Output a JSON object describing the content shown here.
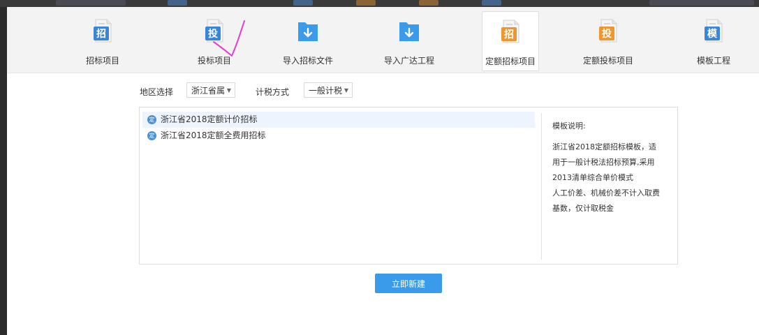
{
  "toolbar": {
    "items": [
      {
        "label": "招标项目",
        "glyph": "招",
        "icon": "zhao-document-icon",
        "color": "#3a86d6",
        "active": false
      },
      {
        "label": "投标项目",
        "glyph": "投",
        "icon": "tou-document-icon",
        "color": "#3a86d6",
        "active": false
      },
      {
        "label": "导入招标文件",
        "glyph": "⬇",
        "icon": "import-folder-icon",
        "color": "#3a9bea",
        "active": false
      },
      {
        "label": "导入广达工程",
        "glyph": "⬇",
        "icon": "import-folder-icon",
        "color": "#3a9bea",
        "active": false
      },
      {
        "label": "定额招标项目",
        "glyph": "招",
        "icon": "zhao-quota-document-icon",
        "color": "#f0962e",
        "active": true
      },
      {
        "label": "定额投标项目",
        "glyph": "投",
        "icon": "tou-quota-document-icon",
        "color": "#f0962e",
        "active": false
      },
      {
        "label": "模板工程",
        "glyph": "模",
        "icon": "template-document-icon",
        "color": "#3a86d6",
        "active": false
      }
    ]
  },
  "filters": {
    "region_label": "地区选择",
    "region_value": "浙江省属",
    "tax_label": "计税方式",
    "tax_value": "一般计税"
  },
  "templates": {
    "badge": "定",
    "items": [
      {
        "label": "浙江省2018定额计价招标",
        "selected": true
      },
      {
        "label": "浙江省2018定额全费用招标",
        "selected": false
      }
    ]
  },
  "description": {
    "title": "模板说明:",
    "lines": [
      "浙江省2018定额招标模板，适",
      "用于一般计税法招标预算,采用",
      "2013清单综合单价模式",
      "人工价差、机械价差不计入取费",
      "基数，仅计取税金"
    ]
  },
  "actions": {
    "create_label": "立即新建"
  },
  "colors": {
    "accent": "#3a9bea",
    "selected_row": "#edf4fd",
    "annotation": "#e040d0"
  }
}
